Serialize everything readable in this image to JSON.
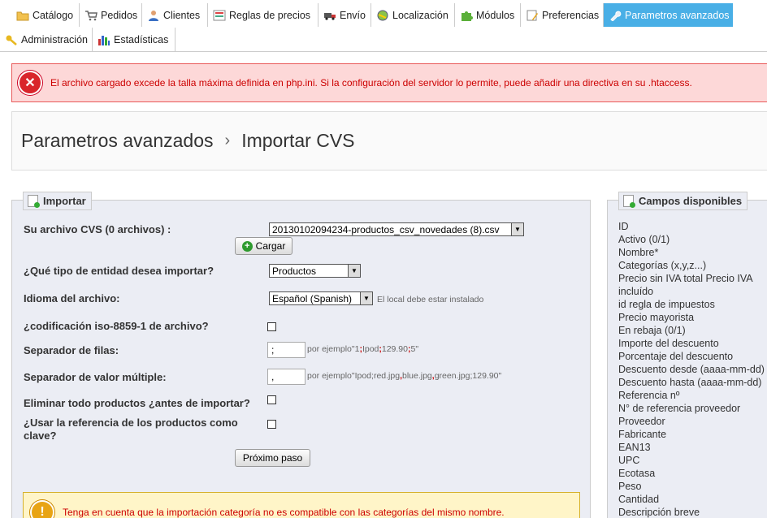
{
  "menu": {
    "row1": [
      {
        "label": "Catálogo",
        "icon": "folder-icon"
      },
      {
        "label": "Pedidos",
        "icon": "cart-icon"
      },
      {
        "label": "Clientes",
        "icon": "users-icon"
      },
      {
        "label": "Reglas de precios",
        "icon": "price-rules-icon"
      },
      {
        "label": "Envío",
        "icon": "truck-icon"
      },
      {
        "label": "Localización",
        "icon": "globe-icon"
      },
      {
        "label": "Módulos",
        "icon": "puzzle-icon"
      },
      {
        "label": "Preferencias",
        "icon": "preferences-icon"
      },
      {
        "label": "Parametros avanzados",
        "icon": "wrench-icon",
        "active": true
      }
    ],
    "row2": [
      {
        "label": "Administración",
        "icon": "key-icon"
      },
      {
        "label": "Estadísticas",
        "icon": "bar-chart-icon"
      }
    ]
  },
  "error": {
    "message": "El archivo cargado excede la talla máxima definida en php.ini. Si la configuración del servidor lo permite, puede añadir una directiva en su .htaccess."
  },
  "header": {
    "parent": "Parametros avanzados",
    "separator": "›",
    "current": "Importar CVS"
  },
  "import": {
    "legend": "Importar",
    "file_label": "Su archivo CVS (0 archivos) :",
    "file_value": "20130102094234-productos_csv_novedades (8).csv",
    "upload_button": "Cargar",
    "entity_label": "¿Qué tipo de entidad desea importar?",
    "entity_value": "Productos",
    "language_label": "Idioma del archivo:",
    "language_value": "Español (Spanish)",
    "language_hint": "El local debe estar instalado",
    "iso_label": "¿codificación iso-8859-1 de archivo?",
    "row_sep_label": "Separador de filas:",
    "row_sep_value": ";",
    "row_sep_hint_parts": [
      "por ejemplo\"1",
      ";",
      "Ipod",
      ";",
      "129.90",
      ";",
      "5\""
    ],
    "multi_sep_label": "Separador de valor múltiple:",
    "multi_sep_value": ",",
    "multi_sep_hint_parts": [
      "por ejemplo\"Ipod;red.jpg",
      ",",
      "blue.jpg",
      ",",
      "green.jpg;129.90\""
    ],
    "delete_label": "Eliminar todo productos ¿antes de importar?",
    "use_ref_label": "¿Usar la referencia de los productos como clave?",
    "next_button": "Próximo paso",
    "warning": "Tenga en cuenta que la importación categoría no es compatible con las categorías del mismo nombre."
  },
  "fields": {
    "legend": "Campos disponibles",
    "items": [
      "ID",
      "Activo (0/1)",
      "Nombre*",
      "Categorías (x,y,z...)",
      "Precio sin IVA total Precio IVA incluído",
      "id regla de impuestos",
      "Precio mayorista",
      "En rebaja (0/1)",
      "Importe del descuento",
      "Porcentaje del descuento",
      "Descuento desde (aaaa-mm-dd)",
      "Descuento hasta (aaaa-mm-dd)",
      "Referencia nº",
      "N° de referencia proveedor",
      "Proveedor",
      "Fabricante",
      "EAN13",
      "UPC",
      "Ecotasa",
      "Peso",
      "Cantidad",
      "Descripción breve"
    ]
  },
  "colors": {
    "active_tab": "#49afe6",
    "error_bg": "#fdd8d8",
    "error_text": "#cc0000",
    "panel_bg": "#ebedf4",
    "warning_bg": "#fff5c8"
  }
}
